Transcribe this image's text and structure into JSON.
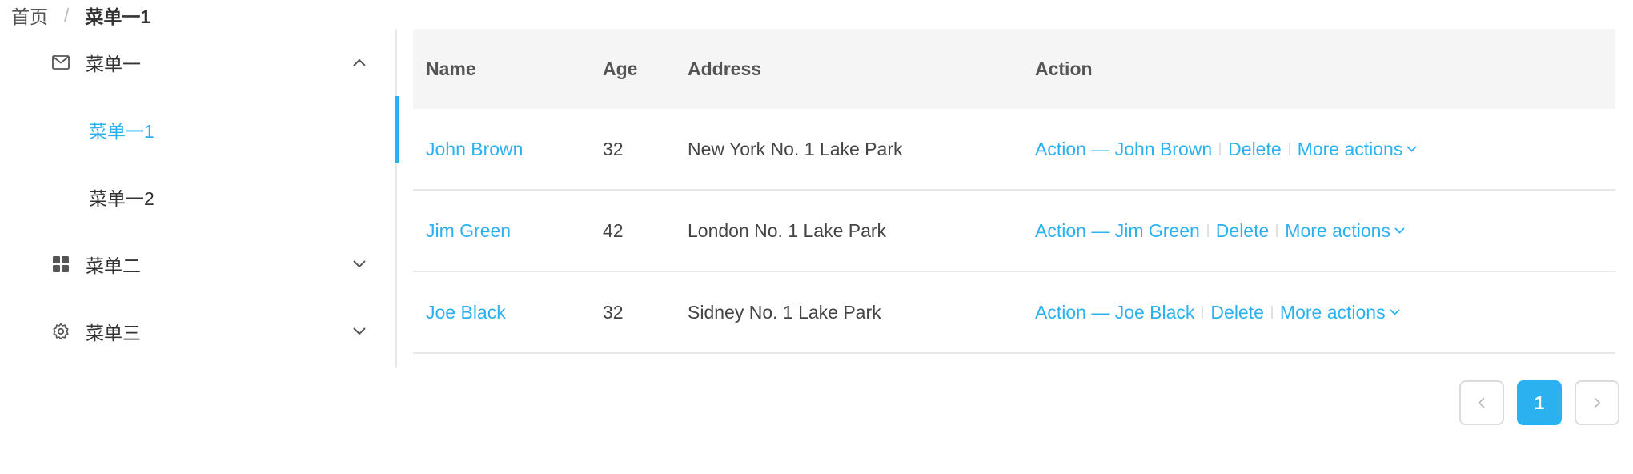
{
  "breadcrumb": {
    "home": "首页",
    "separator": "/",
    "current": "菜单一1"
  },
  "sidebar": {
    "items": [
      {
        "label": "菜单一",
        "icon": "mail-icon",
        "expanded": true
      },
      {
        "label": "菜单一1",
        "selected": true
      },
      {
        "label": "菜单一2"
      },
      {
        "label": "菜单二",
        "icon": "appstore-icon",
        "expanded": false
      },
      {
        "label": "菜单三",
        "icon": "setting-icon",
        "expanded": false
      }
    ]
  },
  "table": {
    "columns": [
      "Name",
      "Age",
      "Address",
      "Action"
    ],
    "rows": [
      {
        "name": "John Brown",
        "age": "32",
        "address": "New York No. 1 Lake Park",
        "action": "Action — John Brown",
        "delete": "Delete",
        "more": "More actions"
      },
      {
        "name": "Jim Green",
        "age": "42",
        "address": "London No. 1 Lake Park",
        "action": "Action — Jim Green",
        "delete": "Delete",
        "more": "More actions"
      },
      {
        "name": "Joe Black",
        "age": "32",
        "address": "Sidney No. 1 Lake Park",
        "action": "Action — Joe Black",
        "delete": "Delete",
        "more": "More actions"
      }
    ]
  },
  "pagination": {
    "current_page": "1"
  },
  "colors": {
    "accent": "#2bb1f0",
    "header_bg": "#f5f5f5",
    "border": "#e8e8e8"
  }
}
